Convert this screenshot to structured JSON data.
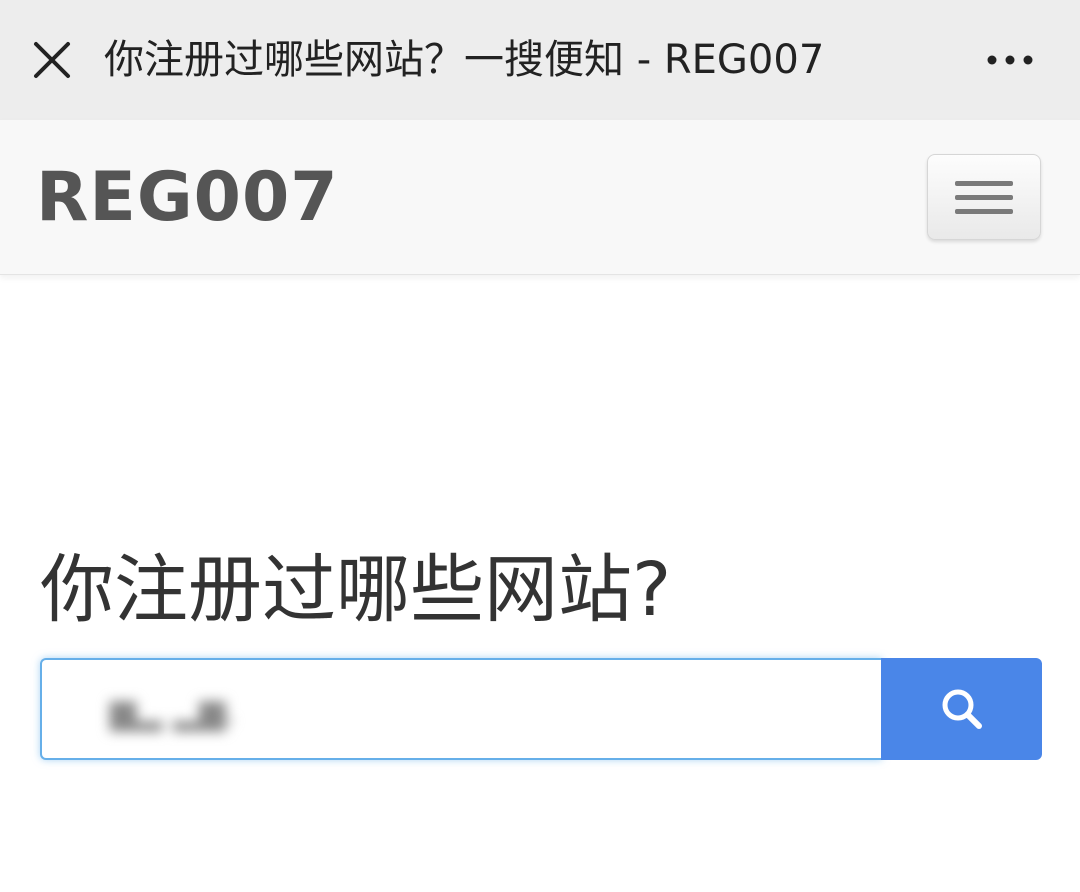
{
  "window": {
    "title": "你注册过哪些网站？一搜便知 - REG007",
    "close_icon": "close-icon",
    "more_icon": "more-horizontal-icon"
  },
  "navbar": {
    "brand": "REG007",
    "menu_icon": "hamburger-menu-icon"
  },
  "main": {
    "headline": "你注册过哪些网站?",
    "search": {
      "value": "▆▂ ▂▆.",
      "value_blurred": true,
      "button_icon": "search-icon"
    }
  },
  "colors": {
    "titlebar_bg": "#ededed",
    "navbar_bg": "#f8f8f8",
    "brand_text": "#555555",
    "input_focus_border": "#66afe9",
    "search_button_bg": "#4a86e8"
  }
}
